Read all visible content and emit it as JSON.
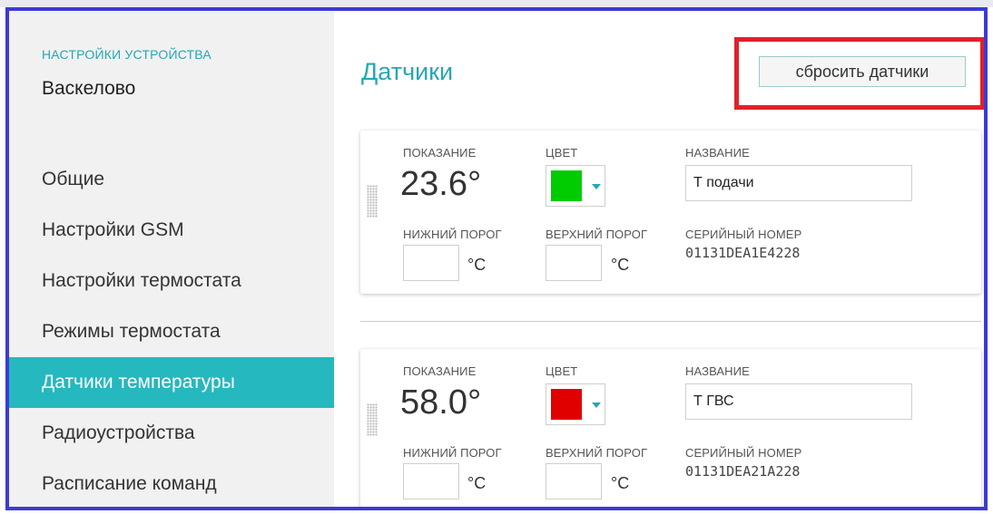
{
  "sidebar": {
    "caption": "НАСТРОЙКИ УСТРОЙСТВА",
    "device_name": "Васкелово",
    "items": [
      {
        "label": "Общие"
      },
      {
        "label": "Настройки GSM"
      },
      {
        "label": "Настройки термостата"
      },
      {
        "label": "Режимы термостата"
      },
      {
        "label": "Датчики температуры"
      },
      {
        "label": "Радиоустройства"
      },
      {
        "label": "Расписание команд"
      }
    ],
    "active_index": 4
  },
  "main": {
    "title": "Датчики",
    "reset_label": "сбросить датчики",
    "labels": {
      "reading": "ПОКАЗАНИЕ",
      "color": "ЦВЕТ",
      "name": "НАЗВАНИЕ",
      "low": "НИЖНИЙ ПОРОГ",
      "high": "ВЕРХНИЙ ПОРОГ",
      "serial": "СЕРИЙНЫЙ НОМЕР",
      "unit": "°C"
    },
    "sensors": [
      {
        "reading": "23.6°",
        "color": "#00cc00",
        "name": "Т подачи",
        "serial": "01131DEA1E4228",
        "low": "",
        "high": ""
      },
      {
        "reading": "58.0°",
        "color": "#e00000",
        "name": "Т ГВС",
        "serial": "01131DEA21A228",
        "low": "",
        "high": ""
      }
    ]
  },
  "colors": {
    "accent": "#26b8bf",
    "highlight": "#e0212b",
    "frame": "#3b3bd6"
  }
}
